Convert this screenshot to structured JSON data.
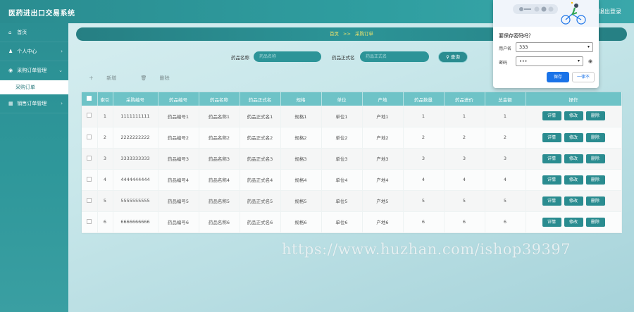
{
  "header": {
    "title": "医药进出口交易系统",
    "logout_label": "退出登录"
  },
  "sidebar": {
    "items": [
      {
        "label": "首页",
        "icon": "home-icon"
      },
      {
        "label": "个人中心",
        "icon": "user-icon"
      },
      {
        "label": "采购订单管理",
        "icon": "location-icon"
      },
      {
        "label": "销售订单管理",
        "icon": "grid-icon"
      }
    ],
    "sub_item": "采购订单"
  },
  "breadcrumb": {
    "home": "首页",
    "separator": ">>",
    "current": "采购订单"
  },
  "search": {
    "name_label": "药品名称",
    "name_placeholder": "药品名称",
    "formal_label": "药品正式名",
    "formal_placeholder": "药品正式名",
    "query_label": "查询"
  },
  "actions": {
    "add_label": "新增",
    "delete_label": "删除"
  },
  "table": {
    "headers": [
      "索引",
      "采购编号",
      "药品编号",
      "药品名称",
      "药品正式名",
      "规格",
      "单位",
      "产地",
      "药品数量",
      "药品进价",
      "总金额",
      "操作"
    ],
    "rows": [
      [
        "1",
        "1111111111",
        "药品编号1",
        "药品名称1",
        "药品正式名1",
        "规格1",
        "单位1",
        "产地1",
        "1",
        "1",
        "1"
      ],
      [
        "2",
        "2222222222",
        "药品编号2",
        "药品名称2",
        "药品正式名2",
        "规格2",
        "单位2",
        "产地2",
        "2",
        "2",
        "2"
      ],
      [
        "3",
        "3333333333",
        "药品编号3",
        "药品名称3",
        "药品正式名3",
        "规格3",
        "单位3",
        "产地3",
        "3",
        "3",
        "3"
      ],
      [
        "4",
        "4444444444",
        "药品编号4",
        "药品名称4",
        "药品正式名4",
        "规格4",
        "单位4",
        "产地4",
        "4",
        "4",
        "4"
      ],
      [
        "5",
        "5555555555",
        "药品编号5",
        "药品名称5",
        "药品正式名5",
        "规格5",
        "单位5",
        "产地5",
        "5",
        "5",
        "5"
      ],
      [
        "6",
        "6666666666",
        "药品编号6",
        "药品名称6",
        "药品正式名6",
        "规格6",
        "单位6",
        "产地6",
        "6",
        "6",
        "6"
      ]
    ],
    "op_labels": {
      "detail": "详情",
      "edit": "修改",
      "delete": "删除"
    }
  },
  "watermark": "https://www.huzhan.com/ishop39397",
  "password_popup": {
    "title": "要保存密码吗？",
    "username_label": "用户名",
    "username_value": "333",
    "password_label": "密码",
    "password_value": "•••",
    "save_label": "保存",
    "never_label": "一律不"
  },
  "colors": {
    "primary": "#2a8c90",
    "header_row": "#6ec3c7",
    "breadcrumb_text": "#f3e56a",
    "popup_button": "#1a73e8"
  }
}
